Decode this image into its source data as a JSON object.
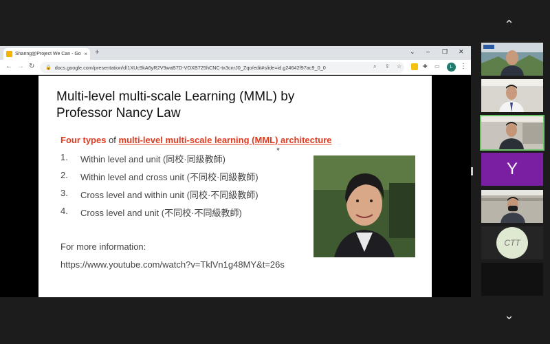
{
  "browser": {
    "tab_title": "Sharing@Project We Can - Go",
    "url": "docs.google.com/presentation/d/1XUc9kA6yR2V9waB7D-VOXB725hCNC-tx3cnrJ0_Zqo/edit#slide=id.g24642f97ac9_0_0",
    "profile_initial": "L"
  },
  "slide": {
    "title": "Multi-level multi-scale Learning (MML) by Professor Nancy Law",
    "subtitle_red": "Four types",
    "subtitle_mid": " of ",
    "subtitle_link": "multi-level multi-scale learning (MML) architecture",
    "items": [
      {
        "num": "1.",
        "text": "Within level and unit (同校·同級教師)"
      },
      {
        "num": "2.",
        "text": "Within level and cross unit (不同校·同級教師)"
      },
      {
        "num": "3.",
        "text": "Cross level and within unit (同校·不同級教師)"
      },
      {
        "num": "4.",
        "text": "Cross level and unit (不同校·不同級教師)"
      }
    ],
    "info_label": "For more information:",
    "info_url": "https://www.youtube.com/watch?v=TklVn1g48MY&t=26s"
  },
  "participants": {
    "initial_tile": "Y",
    "ctt_tile": "CTT"
  },
  "colors": {
    "accent_red": "#e03a1e",
    "active_border": "#6ec56c",
    "avatar_purple": "#7a1fa2"
  }
}
